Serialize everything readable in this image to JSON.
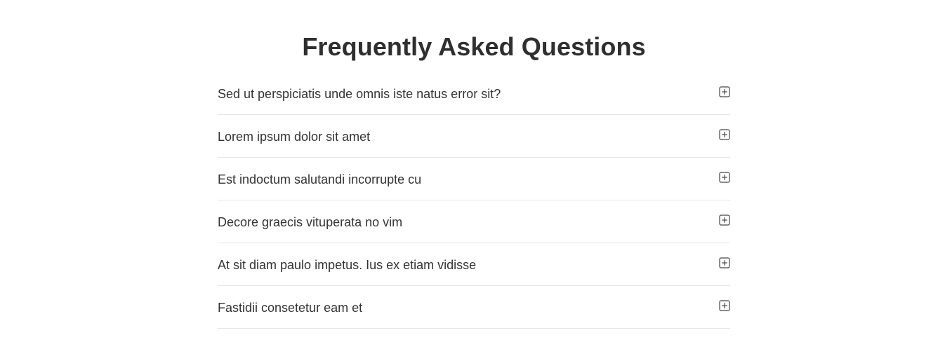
{
  "faq": {
    "title": "Frequently Asked Questions",
    "items": [
      {
        "question": "Sed ut perspiciatis unde omnis iste natus error sit?",
        "icon": "plus-square-icon"
      },
      {
        "question": "Lorem ipsum dolor sit amet",
        "icon": "plus-square-icon"
      },
      {
        "question": "Est indoctum salutandi incorrupte cu",
        "icon": "plus-square-icon"
      },
      {
        "question": "Decore graecis vituperata no vim",
        "icon": "plus-square-icon"
      },
      {
        "question": "At sit diam paulo impetus. Ius ex etiam vidisse",
        "icon": "plus-square-icon"
      },
      {
        "question": "Fastidii consetetur eam et",
        "icon": "plus-square-icon"
      }
    ]
  },
  "colors": {
    "text": "#2f2f2f",
    "divider": "#e6e6e6",
    "icon": "#444444"
  }
}
